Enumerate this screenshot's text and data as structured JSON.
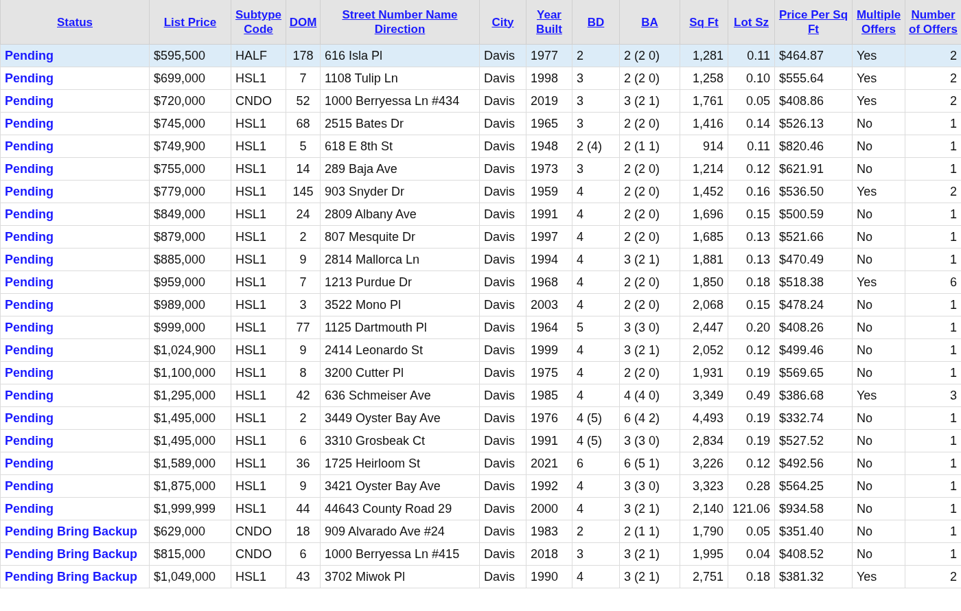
{
  "table": {
    "columns": [
      "Status",
      "List Price",
      "Subtype Code",
      "DOM",
      "Street Number Name Direction",
      "City",
      "Year Built",
      "BD",
      "BA",
      "Sq Ft",
      "Lot Sz",
      "Price Per Sq Ft",
      "Multiple Offers",
      "Number of Offers"
    ],
    "rows": [
      {
        "selected": true,
        "cells": [
          "Pending",
          "$595,500",
          "HALF",
          "178",
          "616 Isla Pl",
          "Davis",
          "1977",
          "2",
          "2 (2 0)",
          "1,281",
          "0.11",
          "$464.87",
          "Yes",
          "2"
        ]
      },
      {
        "selected": false,
        "cells": [
          "Pending",
          "$699,000",
          "HSL1",
          "7",
          "1108 Tulip Ln",
          "Davis",
          "1998",
          "3",
          "2 (2 0)",
          "1,258",
          "0.10",
          "$555.64",
          "Yes",
          "2"
        ]
      },
      {
        "selected": false,
        "cells": [
          "Pending",
          "$720,000",
          "CNDO",
          "52",
          "1000 Berryessa Ln #434",
          "Davis",
          "2019",
          "3",
          "3 (2 1)",
          "1,761",
          "0.05",
          "$408.86",
          "Yes",
          "2"
        ]
      },
      {
        "selected": false,
        "cells": [
          "Pending",
          "$745,000",
          "HSL1",
          "68",
          "2515 Bates Dr",
          "Davis",
          "1965",
          "3",
          "2 (2 0)",
          "1,416",
          "0.14",
          "$526.13",
          "No",
          "1"
        ]
      },
      {
        "selected": false,
        "cells": [
          "Pending",
          "$749,900",
          "HSL1",
          "5",
          "618 E 8th St",
          "Davis",
          "1948",
          "2 (4)",
          "2 (1 1)",
          "914",
          "0.11",
          "$820.46",
          "No",
          "1"
        ]
      },
      {
        "selected": false,
        "cells": [
          "Pending",
          "$755,000",
          "HSL1",
          "14",
          "289 Baja Ave",
          "Davis",
          "1973",
          "3",
          "2 (2 0)",
          "1,214",
          "0.12",
          "$621.91",
          "No",
          "1"
        ]
      },
      {
        "selected": false,
        "cells": [
          "Pending",
          "$779,000",
          "HSL1",
          "145",
          "903 Snyder Dr",
          "Davis",
          "1959",
          "4",
          "2 (2 0)",
          "1,452",
          "0.16",
          "$536.50",
          "Yes",
          "2"
        ]
      },
      {
        "selected": false,
        "cells": [
          "Pending",
          "$849,000",
          "HSL1",
          "24",
          "2809 Albany Ave",
          "Davis",
          "1991",
          "4",
          "2 (2 0)",
          "1,696",
          "0.15",
          "$500.59",
          "No",
          "1"
        ]
      },
      {
        "selected": false,
        "cells": [
          "Pending",
          "$879,000",
          "HSL1",
          "2",
          "807 Mesquite Dr",
          "Davis",
          "1997",
          "4",
          "2 (2 0)",
          "1,685",
          "0.13",
          "$521.66",
          "No",
          "1"
        ]
      },
      {
        "selected": false,
        "cells": [
          "Pending",
          "$885,000",
          "HSL1",
          "9",
          "2814 Mallorca Ln",
          "Davis",
          "1994",
          "4",
          "3 (2 1)",
          "1,881",
          "0.13",
          "$470.49",
          "No",
          "1"
        ]
      },
      {
        "selected": false,
        "cells": [
          "Pending",
          "$959,000",
          "HSL1",
          "7",
          "1213 Purdue Dr",
          "Davis",
          "1968",
          "4",
          "2 (2 0)",
          "1,850",
          "0.18",
          "$518.38",
          "Yes",
          "6"
        ]
      },
      {
        "selected": false,
        "cells": [
          "Pending",
          "$989,000",
          "HSL1",
          "3",
          "3522 Mono Pl",
          "Davis",
          "2003",
          "4",
          "2 (2 0)",
          "2,068",
          "0.15",
          "$478.24",
          "No",
          "1"
        ]
      },
      {
        "selected": false,
        "cells": [
          "Pending",
          "$999,000",
          "HSL1",
          "77",
          "1125 Dartmouth Pl",
          "Davis",
          "1964",
          "5",
          "3 (3 0)",
          "2,447",
          "0.20",
          "$408.26",
          "No",
          "1"
        ]
      },
      {
        "selected": false,
        "cells": [
          "Pending",
          "$1,024,900",
          "HSL1",
          "9",
          "2414 Leonardo St",
          "Davis",
          "1999",
          "4",
          "3 (2 1)",
          "2,052",
          "0.12",
          "$499.46",
          "No",
          "1"
        ]
      },
      {
        "selected": false,
        "cells": [
          "Pending",
          "$1,100,000",
          "HSL1",
          "8",
          "3200 Cutter Pl",
          "Davis",
          "1975",
          "4",
          "2 (2 0)",
          "1,931",
          "0.19",
          "$569.65",
          "No",
          "1"
        ]
      },
      {
        "selected": false,
        "cells": [
          "Pending",
          "$1,295,000",
          "HSL1",
          "42",
          "636 Schmeiser Ave",
          "Davis",
          "1985",
          "4",
          "4 (4 0)",
          "3,349",
          "0.49",
          "$386.68",
          "Yes",
          "3"
        ]
      },
      {
        "selected": false,
        "cells": [
          "Pending",
          "$1,495,000",
          "HSL1",
          "2",
          "3449 Oyster Bay Ave",
          "Davis",
          "1976",
          "4 (5)",
          "6 (4 2)",
          "4,493",
          "0.19",
          "$332.74",
          "No",
          "1"
        ]
      },
      {
        "selected": false,
        "cells": [
          "Pending",
          "$1,495,000",
          "HSL1",
          "6",
          "3310 Grosbeak Ct",
          "Davis",
          "1991",
          "4 (5)",
          "3 (3 0)",
          "2,834",
          "0.19",
          "$527.52",
          "No",
          "1"
        ]
      },
      {
        "selected": false,
        "cells": [
          "Pending",
          "$1,589,000",
          "HSL1",
          "36",
          "1725 Heirloom St",
          "Davis",
          "2021",
          "6",
          "6 (5 1)",
          "3,226",
          "0.12",
          "$492.56",
          "No",
          "1"
        ]
      },
      {
        "selected": false,
        "cells": [
          "Pending",
          "$1,875,000",
          "HSL1",
          "9",
          "3421 Oyster Bay Ave",
          "Davis",
          "1992",
          "4",
          "3 (3 0)",
          "3,323",
          "0.28",
          "$564.25",
          "No",
          "1"
        ]
      },
      {
        "selected": false,
        "cells": [
          "Pending",
          "$1,999,999",
          "HSL1",
          "44",
          "44643 County Road 29",
          "Davis",
          "2000",
          "4",
          "3 (2 1)",
          "2,140",
          "121.06",
          "$934.58",
          "No",
          "1"
        ]
      },
      {
        "selected": false,
        "cells": [
          "Pending Bring Backup",
          "$629,000",
          "CNDO",
          "18",
          "909 Alvarado Ave #24",
          "Davis",
          "1983",
          "2",
          "2 (1 1)",
          "1,790",
          "0.05",
          "$351.40",
          "No",
          "1"
        ]
      },
      {
        "selected": false,
        "cells": [
          "Pending Bring Backup",
          "$815,000",
          "CNDO",
          "6",
          "1000 Berryessa Ln #415",
          "Davis",
          "2018",
          "3",
          "3 (2 1)",
          "1,995",
          "0.04",
          "$408.52",
          "No",
          "1"
        ]
      },
      {
        "selected": false,
        "cells": [
          "Pending Bring Backup",
          "$1,049,000",
          "HSL1",
          "43",
          "3702 Miwok Pl",
          "Davis",
          "1990",
          "4",
          "3 (2 1)",
          "2,751",
          "0.18",
          "$381.32",
          "Yes",
          "2"
        ]
      }
    ]
  }
}
